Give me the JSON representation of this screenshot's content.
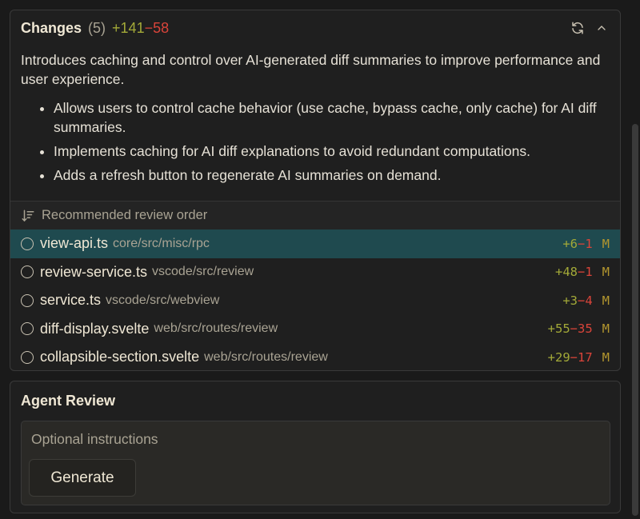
{
  "changes": {
    "title": "Changes",
    "count": "(5)",
    "additions": "+141",
    "deletions": "−58",
    "description": "Introduces caching and control over AI-generated diff summaries to improve performance and user experience.",
    "bullets": [
      "Allows users to control cache behavior (use cache, bypass cache, only cache) for AI diff summaries.",
      "Implements caching for AI diff explanations to avoid redundant computations.",
      "Adds a refresh button to regenerate AI summaries on demand."
    ],
    "icons": [
      "refresh-icon",
      "chevron-up-icon"
    ]
  },
  "review_order": {
    "label": "Recommended review order",
    "icon": "sort-descending-icon",
    "files": [
      {
        "name": "view-api.ts",
        "path": "core/src/misc/rpc",
        "add": "+6",
        "del": "−1",
        "status": "M",
        "active": true
      },
      {
        "name": "review-service.ts",
        "path": "vscode/src/review",
        "add": "+48",
        "del": "−1",
        "status": "M"
      },
      {
        "name": "service.ts",
        "path": "vscode/src/webview",
        "add": "+3",
        "del": "−4",
        "status": "M"
      },
      {
        "name": "diff-display.svelte",
        "path": "web/src/routes/review",
        "add": "+55",
        "del": "−35",
        "status": "M"
      },
      {
        "name": "collapsible-section.svelte",
        "path": "web/src/routes/review",
        "add": "+29",
        "del": "−17",
        "status": "M"
      }
    ]
  },
  "agent_review": {
    "title": "Agent Review",
    "placeholder": "Optional instructions",
    "generate_label": "Generate"
  },
  "colors": {
    "background": "#1a1a1a",
    "active_row": "#1f4a4f",
    "addition": "#a3a938",
    "deletion": "#d9443a",
    "modified": "#b3962e"
  }
}
